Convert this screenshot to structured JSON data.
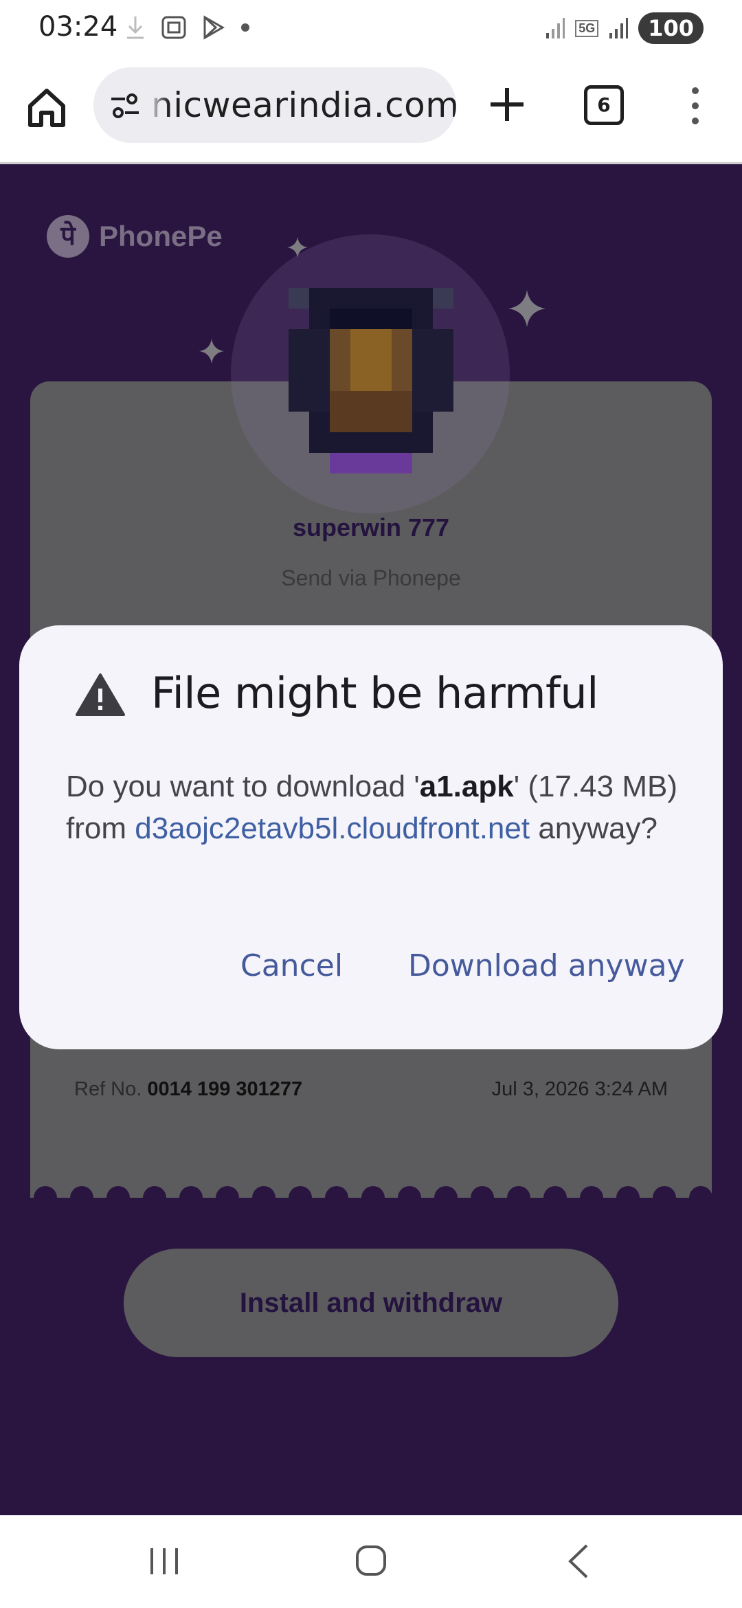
{
  "status_bar": {
    "time": "03:24",
    "network": "5G",
    "battery": "100",
    "icons": [
      "download-icon",
      "screenshot-icon",
      "play-store-icon",
      "dot-icon",
      "signal-icon",
      "signal-icon"
    ]
  },
  "browser": {
    "url": "nicwearindia.com",
    "tab_count": "6"
  },
  "page": {
    "brand": "PhonePe",
    "brand_glyph": "पे",
    "payee_name": "superwin 777",
    "send_via": "Send via Phonepe",
    "ref_label": "Ref No.",
    "ref_number": "0014 199 301277",
    "date": "Jul 3, 2026 3:24 AM",
    "install_button": "Install and withdraw"
  },
  "dialog": {
    "title": "File might be harmful",
    "body_prefix": "Do you want to download '",
    "file_name": "a1.apk",
    "body_middle": "' (17.43 MB) from ",
    "host": "d3aojc2etavb5l.cloudfront.net",
    "body_suffix": " anyway?",
    "cancel_label": "Cancel",
    "download_label": "Download anyway"
  },
  "colors": {
    "page_bg": "#2a1541",
    "dialog_bg": "#f5f4fb",
    "link_blue": "#3f5fa3",
    "button_blue": "#455a9b"
  }
}
